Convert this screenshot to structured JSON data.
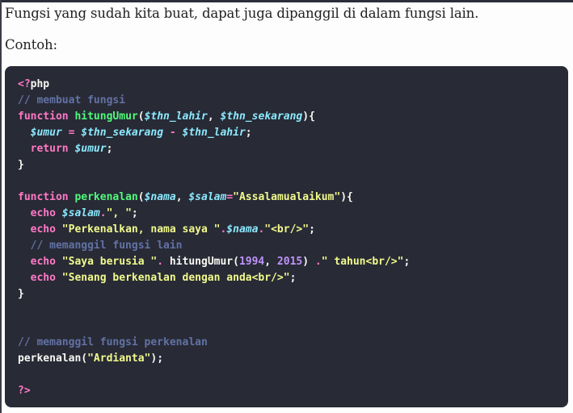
{
  "content": {
    "paragraph_1": "Fungsi yang sudah kita buat, dapat juga dipanggil di dalam fungsi lain.",
    "paragraph_2": "Contoh:"
  },
  "code": {
    "language": "php",
    "lines": [
      [
        {
          "t": "kw",
          "v": "<?"
        },
        {
          "t": "pl",
          "v": "php"
        }
      ],
      [
        {
          "t": "cm",
          "v": "// membuat fungsi"
        }
      ],
      [
        {
          "t": "kw",
          "v": "function"
        },
        {
          "t": "pl",
          "v": " "
        },
        {
          "t": "fn",
          "v": "hitungUmur"
        },
        {
          "t": "pl",
          "v": "("
        },
        {
          "t": "var",
          "v": "$thn_lahir"
        },
        {
          "t": "pl",
          "v": ", "
        },
        {
          "t": "var",
          "v": "$thn_sekarang"
        },
        {
          "t": "pl",
          "v": "){"
        }
      ],
      [
        {
          "t": "pl",
          "v": "  "
        },
        {
          "t": "var",
          "v": "$umur"
        },
        {
          "t": "pl",
          "v": " "
        },
        {
          "t": "op",
          "v": "="
        },
        {
          "t": "pl",
          "v": " "
        },
        {
          "t": "var",
          "v": "$thn_sekarang"
        },
        {
          "t": "pl",
          "v": " "
        },
        {
          "t": "op",
          "v": "-"
        },
        {
          "t": "pl",
          "v": " "
        },
        {
          "t": "var",
          "v": "$thn_lahir"
        },
        {
          "t": "pl",
          "v": ";"
        }
      ],
      [
        {
          "t": "pl",
          "v": "  "
        },
        {
          "t": "kw",
          "v": "return"
        },
        {
          "t": "pl",
          "v": " "
        },
        {
          "t": "var",
          "v": "$umur"
        },
        {
          "t": "pl",
          "v": ";"
        }
      ],
      [
        {
          "t": "pl",
          "v": "}"
        }
      ],
      [],
      [
        {
          "t": "kw",
          "v": "function"
        },
        {
          "t": "pl",
          "v": " "
        },
        {
          "t": "fn",
          "v": "perkenalan"
        },
        {
          "t": "pl",
          "v": "("
        },
        {
          "t": "var",
          "v": "$nama"
        },
        {
          "t": "pl",
          "v": ", "
        },
        {
          "t": "var",
          "v": "$salam"
        },
        {
          "t": "op",
          "v": "="
        },
        {
          "t": "str",
          "v": "\"Assalamualaikum\""
        },
        {
          "t": "pl",
          "v": "){"
        }
      ],
      [
        {
          "t": "pl",
          "v": "  "
        },
        {
          "t": "kw",
          "v": "echo"
        },
        {
          "t": "pl",
          "v": " "
        },
        {
          "t": "var",
          "v": "$salam"
        },
        {
          "t": "op",
          "v": "."
        },
        {
          "t": "str",
          "v": "\", \""
        },
        {
          "t": "pl",
          "v": ";"
        }
      ],
      [
        {
          "t": "pl",
          "v": "  "
        },
        {
          "t": "kw",
          "v": "echo"
        },
        {
          "t": "pl",
          "v": " "
        },
        {
          "t": "str",
          "v": "\"Perkenalkan, nama saya \""
        },
        {
          "t": "op",
          "v": "."
        },
        {
          "t": "var",
          "v": "$nama"
        },
        {
          "t": "op",
          "v": "."
        },
        {
          "t": "str",
          "v": "\"<br/>\""
        },
        {
          "t": "pl",
          "v": ";"
        }
      ],
      [
        {
          "t": "pl",
          "v": "  "
        },
        {
          "t": "cm",
          "v": "// memanggil fungsi lain"
        }
      ],
      [
        {
          "t": "pl",
          "v": "  "
        },
        {
          "t": "kw",
          "v": "echo"
        },
        {
          "t": "pl",
          "v": " "
        },
        {
          "t": "str",
          "v": "\"Saya berusia \""
        },
        {
          "t": "op",
          "v": "."
        },
        {
          "t": "pl",
          "v": " hitungUmur("
        },
        {
          "t": "num",
          "v": "1994"
        },
        {
          "t": "pl",
          "v": ", "
        },
        {
          "t": "num",
          "v": "2015"
        },
        {
          "t": "pl",
          "v": ") "
        },
        {
          "t": "op",
          "v": "."
        },
        {
          "t": "str",
          "v": "\" tahun<br/>\""
        },
        {
          "t": "pl",
          "v": ";"
        }
      ],
      [
        {
          "t": "pl",
          "v": "  "
        },
        {
          "t": "kw",
          "v": "echo"
        },
        {
          "t": "pl",
          "v": " "
        },
        {
          "t": "str",
          "v": "\"Senang berkenalan dengan anda<br/>\""
        },
        {
          "t": "pl",
          "v": ";"
        }
      ],
      [
        {
          "t": "pl",
          "v": "}"
        }
      ],
      [],
      [],
      [
        {
          "t": "cm",
          "v": "// memanggil fungsi perkenalan"
        }
      ],
      [
        {
          "t": "pl",
          "v": "perkenalan("
        },
        {
          "t": "str",
          "v": "\"Ardianta\""
        },
        {
          "t": "pl",
          "v": ");"
        }
      ],
      [],
      [
        {
          "t": "kw",
          "v": "?>"
        }
      ]
    ]
  },
  "colors": {
    "code_background": "#282a36",
    "keyword": "#ff79c6",
    "function_name": "#50fa7b",
    "variable": "#8be9fd",
    "string": "#f1fa8c",
    "number": "#bd93f9",
    "comment": "#6272a4",
    "plain": "#f8f8f2"
  }
}
